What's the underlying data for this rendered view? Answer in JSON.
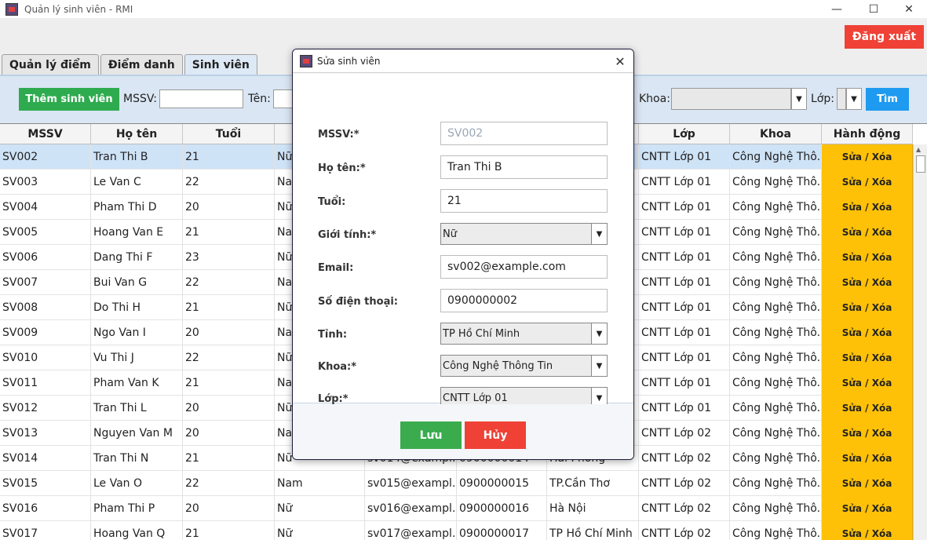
{
  "window": {
    "title": "Quản lý sinh viên - RMI",
    "minimize_icon": "minimize-icon",
    "maximize_icon": "maximize-icon",
    "close_icon": "close-icon"
  },
  "header": {
    "logout_label": "Đăng xuất",
    "logout_color": "#ef4136"
  },
  "tabs": [
    {
      "label": "Quản lý điểm"
    },
    {
      "label": "Điểm danh"
    },
    {
      "label": "Sinh viên",
      "active": true
    }
  ],
  "toolbar": {
    "add_label": "Thêm sinh viên",
    "mssv_label": "MSSV:",
    "name_label": "Tên:",
    "khoa_label": "Khoa:",
    "lop_label": "Lớp:",
    "find_label": "Tìm",
    "mssv_value": "",
    "name_value": "",
    "khoa_value": "",
    "lop_value": ""
  },
  "table": {
    "columns": [
      "MSSV",
      "Họ tên",
      "Tuổi",
      "",
      "",
      "",
      "",
      "Lớp",
      "Khoa",
      "Hành động"
    ],
    "action_label": "Sửa / Xóa",
    "rows": [
      [
        "SV002",
        "Tran Thi B",
        "21",
        "Nữ",
        "",
        "",
        "",
        "CNTT Lớp 01",
        "Công Nghệ Thô..."
      ],
      [
        "SV003",
        "Le Van C",
        "22",
        "Nam",
        "",
        "",
        "",
        "CNTT Lớp 01",
        "Công Nghệ Thô..."
      ],
      [
        "SV004",
        "Pham Thi D",
        "20",
        "Nữ",
        "",
        "",
        "",
        "CNTT Lớp 01",
        "Công Nghệ Thô..."
      ],
      [
        "SV005",
        "Hoang Van E",
        "21",
        "Nam",
        "",
        "",
        "",
        "CNTT Lớp 01",
        "Công Nghệ Thô..."
      ],
      [
        "SV006",
        "Dang Thi F",
        "23",
        "Nữ",
        "",
        "",
        "",
        "CNTT Lớp 01",
        "Công Nghệ Thô..."
      ],
      [
        "SV007",
        "Bui Van G",
        "22",
        "Nam",
        "",
        "",
        "",
        "CNTT Lớp 01",
        "Công Nghệ Thô..."
      ],
      [
        "SV008",
        "Do Thi H",
        "21",
        "Nữ",
        "",
        "",
        "",
        "CNTT Lớp 01",
        "Công Nghệ Thô..."
      ],
      [
        "SV009",
        "Ngo Van I",
        "20",
        "Nam",
        "",
        "",
        "",
        "CNTT Lớp 01",
        "Công Nghệ Thô..."
      ],
      [
        "SV010",
        "Vu Thi J",
        "22",
        "Nữ",
        "",
        "",
        "",
        "CNTT Lớp 01",
        "Công Nghệ Thô..."
      ],
      [
        "SV011",
        "Pham Van K",
        "21",
        "Nam",
        "",
        "",
        "",
        "CNTT Lớp 01",
        "Công Nghệ Thô..."
      ],
      [
        "SV012",
        "Tran Thi L",
        "20",
        "Nữ",
        "",
        "",
        "",
        "CNTT Lớp 01",
        "Công Nghệ Thô..."
      ],
      [
        "SV013",
        "Nguyen Van M",
        "20",
        "Nam",
        "",
        "",
        "",
        "CNTT Lớp 02",
        "Công Nghệ Thô..."
      ],
      [
        "SV014",
        "Tran Thi N",
        "21",
        "Nữ",
        "sv014@exampl...",
        "0900000014",
        "Hải Phòng",
        "CNTT Lớp 02",
        "Công Nghệ Thô..."
      ],
      [
        "SV015",
        "Le Van O",
        "22",
        "Nam",
        "sv015@exampl...",
        "0900000015",
        "TP.Cần Thơ",
        "CNTT Lớp 02",
        "Công Nghệ Thô..."
      ],
      [
        "SV016",
        "Pham Thi P",
        "20",
        "Nữ",
        "sv016@exampl...",
        "0900000016",
        "Hà Nội",
        "CNTT Lớp 02",
        "Công Nghệ Thô..."
      ],
      [
        "SV017",
        "Hoang Van Q",
        "21",
        "Nữ",
        "sv017@exampl...",
        "0900000017",
        "TP Hồ Chí Minh",
        "CNTT Lớp 02",
        "Công Nghệ Thô..."
      ]
    ]
  },
  "dialog": {
    "title": "Sửa sinh viên",
    "fields": {
      "mssv": {
        "label": "MSSV:*",
        "value": "SV002"
      },
      "name": {
        "label": "Họ tên:*",
        "value": "Tran Thi B"
      },
      "age": {
        "label": "Tuổi:",
        "value": "21"
      },
      "gender": {
        "label": "Giới tính:*",
        "value": "Nữ"
      },
      "email": {
        "label": "Email:",
        "value": "sv002@example.com"
      },
      "phone": {
        "label": "Số điện thoại:",
        "value": "0900000002"
      },
      "province": {
        "label": "Tỉnh:",
        "value": "TP Hồ Chí Minh"
      },
      "khoa": {
        "label": "Khoa:*",
        "value": "Công Nghệ Thông Tin"
      },
      "lop": {
        "label": "Lớp:*",
        "value": "CNTT Lớp 01"
      }
    },
    "save_label": "Lưu",
    "cancel_label": "Hủy"
  },
  "colors": {
    "add_button": "#2fab4f",
    "find_button": "#1e9af0",
    "action_cell": "#ffc107",
    "save_button": "#3aac4e",
    "cancel_button": "#ef4136"
  }
}
